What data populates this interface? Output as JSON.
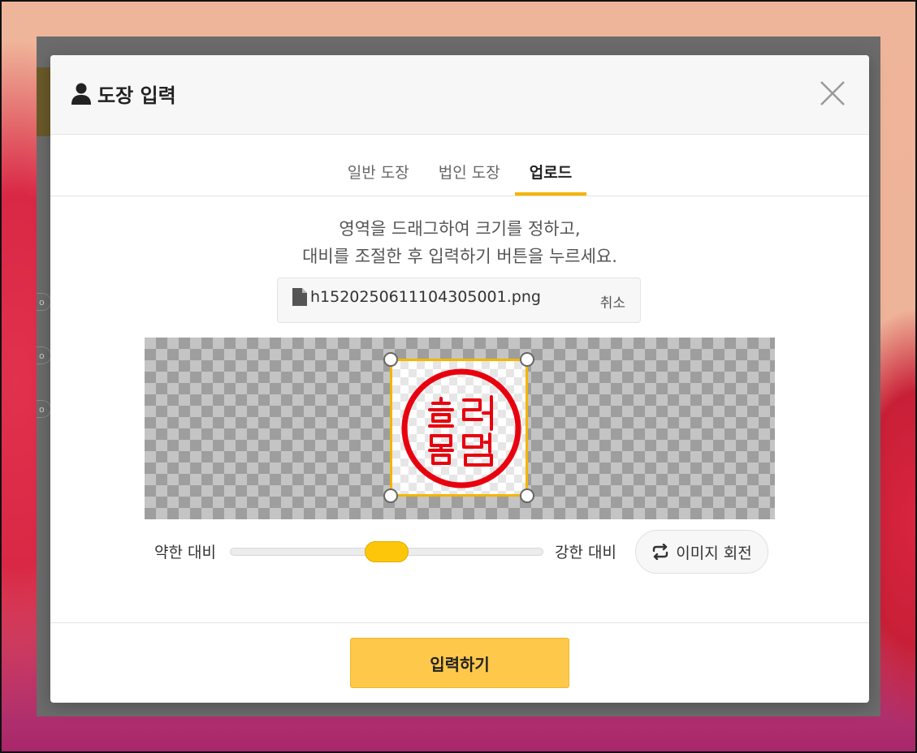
{
  "modal": {
    "title": "도장 입력",
    "title_icon": "user-icon",
    "close_icon": "close-icon"
  },
  "tabs": [
    {
      "label": "일반 도장",
      "active": false
    },
    {
      "label": "법인 도장",
      "active": false
    },
    {
      "label": "업로드",
      "active": true
    }
  ],
  "instructions": {
    "line1": "영역을 드래그하여 크기를 정하고,",
    "line2": "대비를 조절한 후 입력하기 버튼을 누르세요."
  },
  "file": {
    "icon": "file-icon",
    "name": "h1520250611104305001.png",
    "cancel_label": "취소"
  },
  "seal": {
    "color": "#e8000e"
  },
  "contrast": {
    "low_label": "약한 대비",
    "high_label": "강한 대비",
    "value_fraction": 0.5
  },
  "rotate": {
    "icon": "rotate-icon",
    "label": "이미지 회전"
  },
  "submit": {
    "label": "입력하기"
  },
  "colors": {
    "accent": "#f5b400",
    "button": "#fec94a"
  }
}
